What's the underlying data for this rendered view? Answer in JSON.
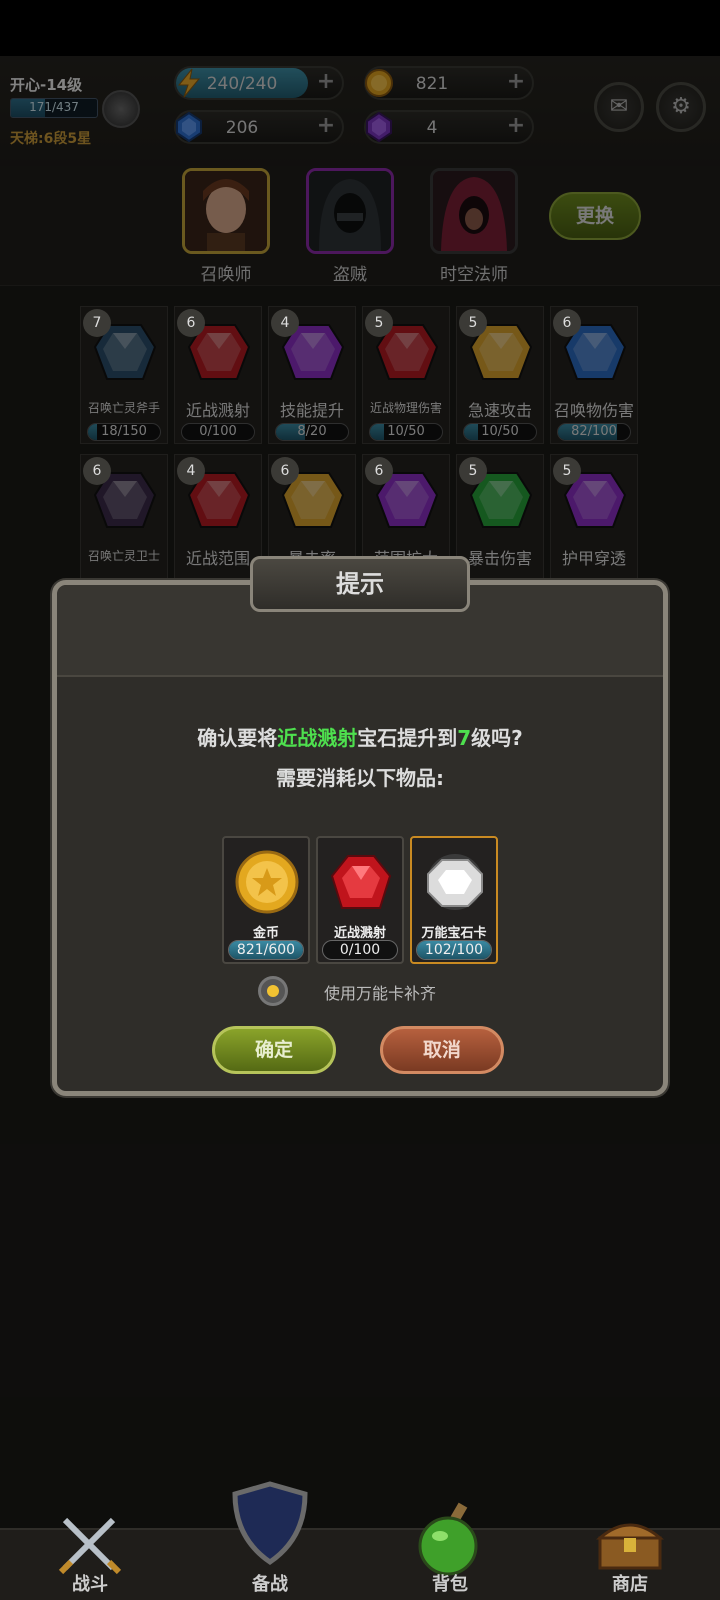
{
  "player": {
    "name": "开心-14级",
    "xp_text": "171/437",
    "xp_progress": 0.39,
    "ladder": "天梯:6段5星"
  },
  "resources": {
    "energy": {
      "value": "240/240",
      "progress": 1.0,
      "icon": "lightning-icon"
    },
    "gold": {
      "value": "821",
      "icon": "coin-icon"
    },
    "blue_gem": {
      "value": "206",
      "icon": "blue-gem-icon"
    },
    "purple_gem": {
      "value": "4",
      "icon": "purple-gem-icon"
    },
    "plus": "+"
  },
  "top_buttons": {
    "mail_icon": "mail-icon",
    "settings_icon": "gear-icon"
  },
  "heroes": [
    {
      "label": "召唤师"
    },
    {
      "label": "盗贼"
    },
    {
      "label": "时空法师"
    }
  ],
  "swap_label": "更换",
  "gems_row1": [
    {
      "level": "7",
      "name": "召唤亡灵斧手",
      "progress_text": "18/150",
      "progress": 0.12,
      "color": "#2b4d6a"
    },
    {
      "level": "6",
      "name": "近战溅射",
      "progress_text": "0/100",
      "progress": 0.0,
      "color": "#b31b22"
    },
    {
      "level": "4",
      "name": "技能提升",
      "progress_text": "8/20",
      "progress": 0.4,
      "color": "#8a2ec4"
    },
    {
      "level": "5",
      "name": "近战物理伤害",
      "progress_text": "10/50",
      "progress": 0.2,
      "color": "#b21a22"
    },
    {
      "level": "5",
      "name": "急速攻击",
      "progress_text": "10/50",
      "progress": 0.2,
      "color": "#d8a12c"
    },
    {
      "level": "6",
      "name": "召唤物伤害",
      "progress_text": "82/100",
      "progress": 0.82,
      "color": "#2b6ac0"
    }
  ],
  "gems_row2": [
    {
      "level": "6",
      "name": "召唤亡灵卫士",
      "color": "#3b2b4a"
    },
    {
      "level": "4",
      "name": "近战范围",
      "color": "#b21a22"
    },
    {
      "level": "6",
      "name": "暴击率",
      "color": "#d8a12c"
    },
    {
      "level": "6",
      "name": "范围扩大",
      "color": "#8a2ec4"
    },
    {
      "level": "5",
      "name": "暴击伤害",
      "color": "#27a13a"
    },
    {
      "level": "5",
      "name": "护甲穿透",
      "color": "#8a2ec4"
    }
  ],
  "dialog": {
    "title": "提示",
    "line1_prefix": "确认要将",
    "line1_gem": "近战溅射",
    "line1_mid": "宝石提升到",
    "line1_level": "7",
    "line1_suffix": "级吗?",
    "line2": "需要消耗以下物品:",
    "items": [
      {
        "name": "金币",
        "count": "821/600",
        "progress": 1.0,
        "icon": "gold-coin-icon"
      },
      {
        "name": "近战溅射",
        "count": "0/100",
        "progress": 0.0,
        "icon": "red-gem-icon"
      },
      {
        "name": "万能宝石卡",
        "count": "102/100",
        "progress": 1.0,
        "icon": "universal-gem-icon"
      }
    ],
    "option_label": "使用万能卡补齐",
    "confirm_label": "确定",
    "cancel_label": "取消"
  },
  "nav": [
    {
      "label": "战斗",
      "icon": "crossed-swords-icon"
    },
    {
      "label": "备战",
      "icon": "shield-icon"
    },
    {
      "label": "背包",
      "icon": "potion-icon"
    },
    {
      "label": "商店",
      "icon": "treasure-chest-icon"
    }
  ]
}
